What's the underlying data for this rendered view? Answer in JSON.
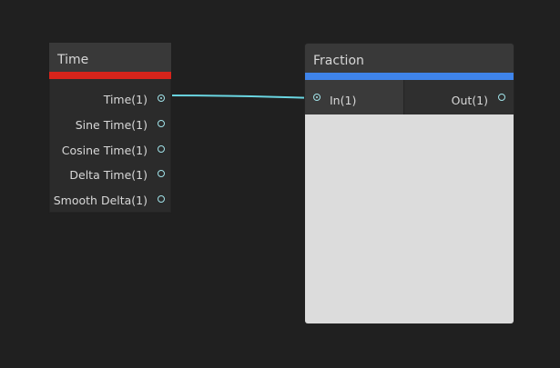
{
  "nodes": {
    "time": {
      "title": "Time",
      "accent": "#d7241b",
      "ports": [
        {
          "label": "Time(1)",
          "connected": true
        },
        {
          "label": "Sine Time(1)",
          "connected": false
        },
        {
          "label": "Cosine Time(1)",
          "connected": false
        },
        {
          "label": "Delta Time(1)",
          "connected": false
        },
        {
          "label": "Smooth Delta(1)",
          "connected": false
        }
      ]
    },
    "fraction": {
      "title": "Fraction",
      "accent": "#3f84ea",
      "input": {
        "label": "In(1)",
        "connected": true
      },
      "output": {
        "label": "Out(1)",
        "connected": false
      }
    }
  },
  "colors": {
    "background": "#202020",
    "port": "#a2e4ea",
    "edge": "#6ad6e2"
  }
}
